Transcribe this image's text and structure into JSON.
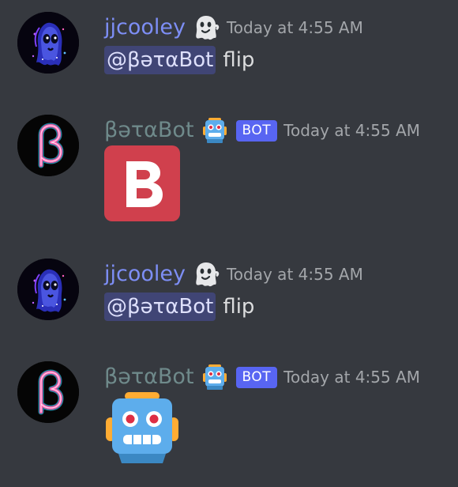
{
  "messages": [
    {
      "author": "jjcooley",
      "author_emoji": "ghost-emoji",
      "timestamp": "Today at 4:55 AM",
      "mention": "@βəταBot",
      "text": "flip"
    },
    {
      "author": "βəταBot",
      "author_emoji": "robot-emoji",
      "bot_tag": "BOT",
      "timestamp": "Today at 4:55 AM",
      "emoji": "regional-indicator-b-emoji"
    },
    {
      "author": "jjcooley",
      "author_emoji": "ghost-emoji",
      "timestamp": "Today at 4:55 AM",
      "mention": "@βəταBot",
      "text": "flip"
    },
    {
      "author": "βəταBot",
      "author_emoji": "robot-emoji",
      "bot_tag": "BOT",
      "timestamp": "Today at 4:55 AM",
      "emoji": "robot-emoji"
    }
  ],
  "colors": {
    "background": "#36393f",
    "user_name": "#7d8ef5",
    "bot_name": "#6f8a8b",
    "bot_tag": "#5865f2",
    "timestamp": "#a3a6aa",
    "text": "#dcddde",
    "mention_bg": "#414675",
    "b_emoji": "#d0404d"
  }
}
